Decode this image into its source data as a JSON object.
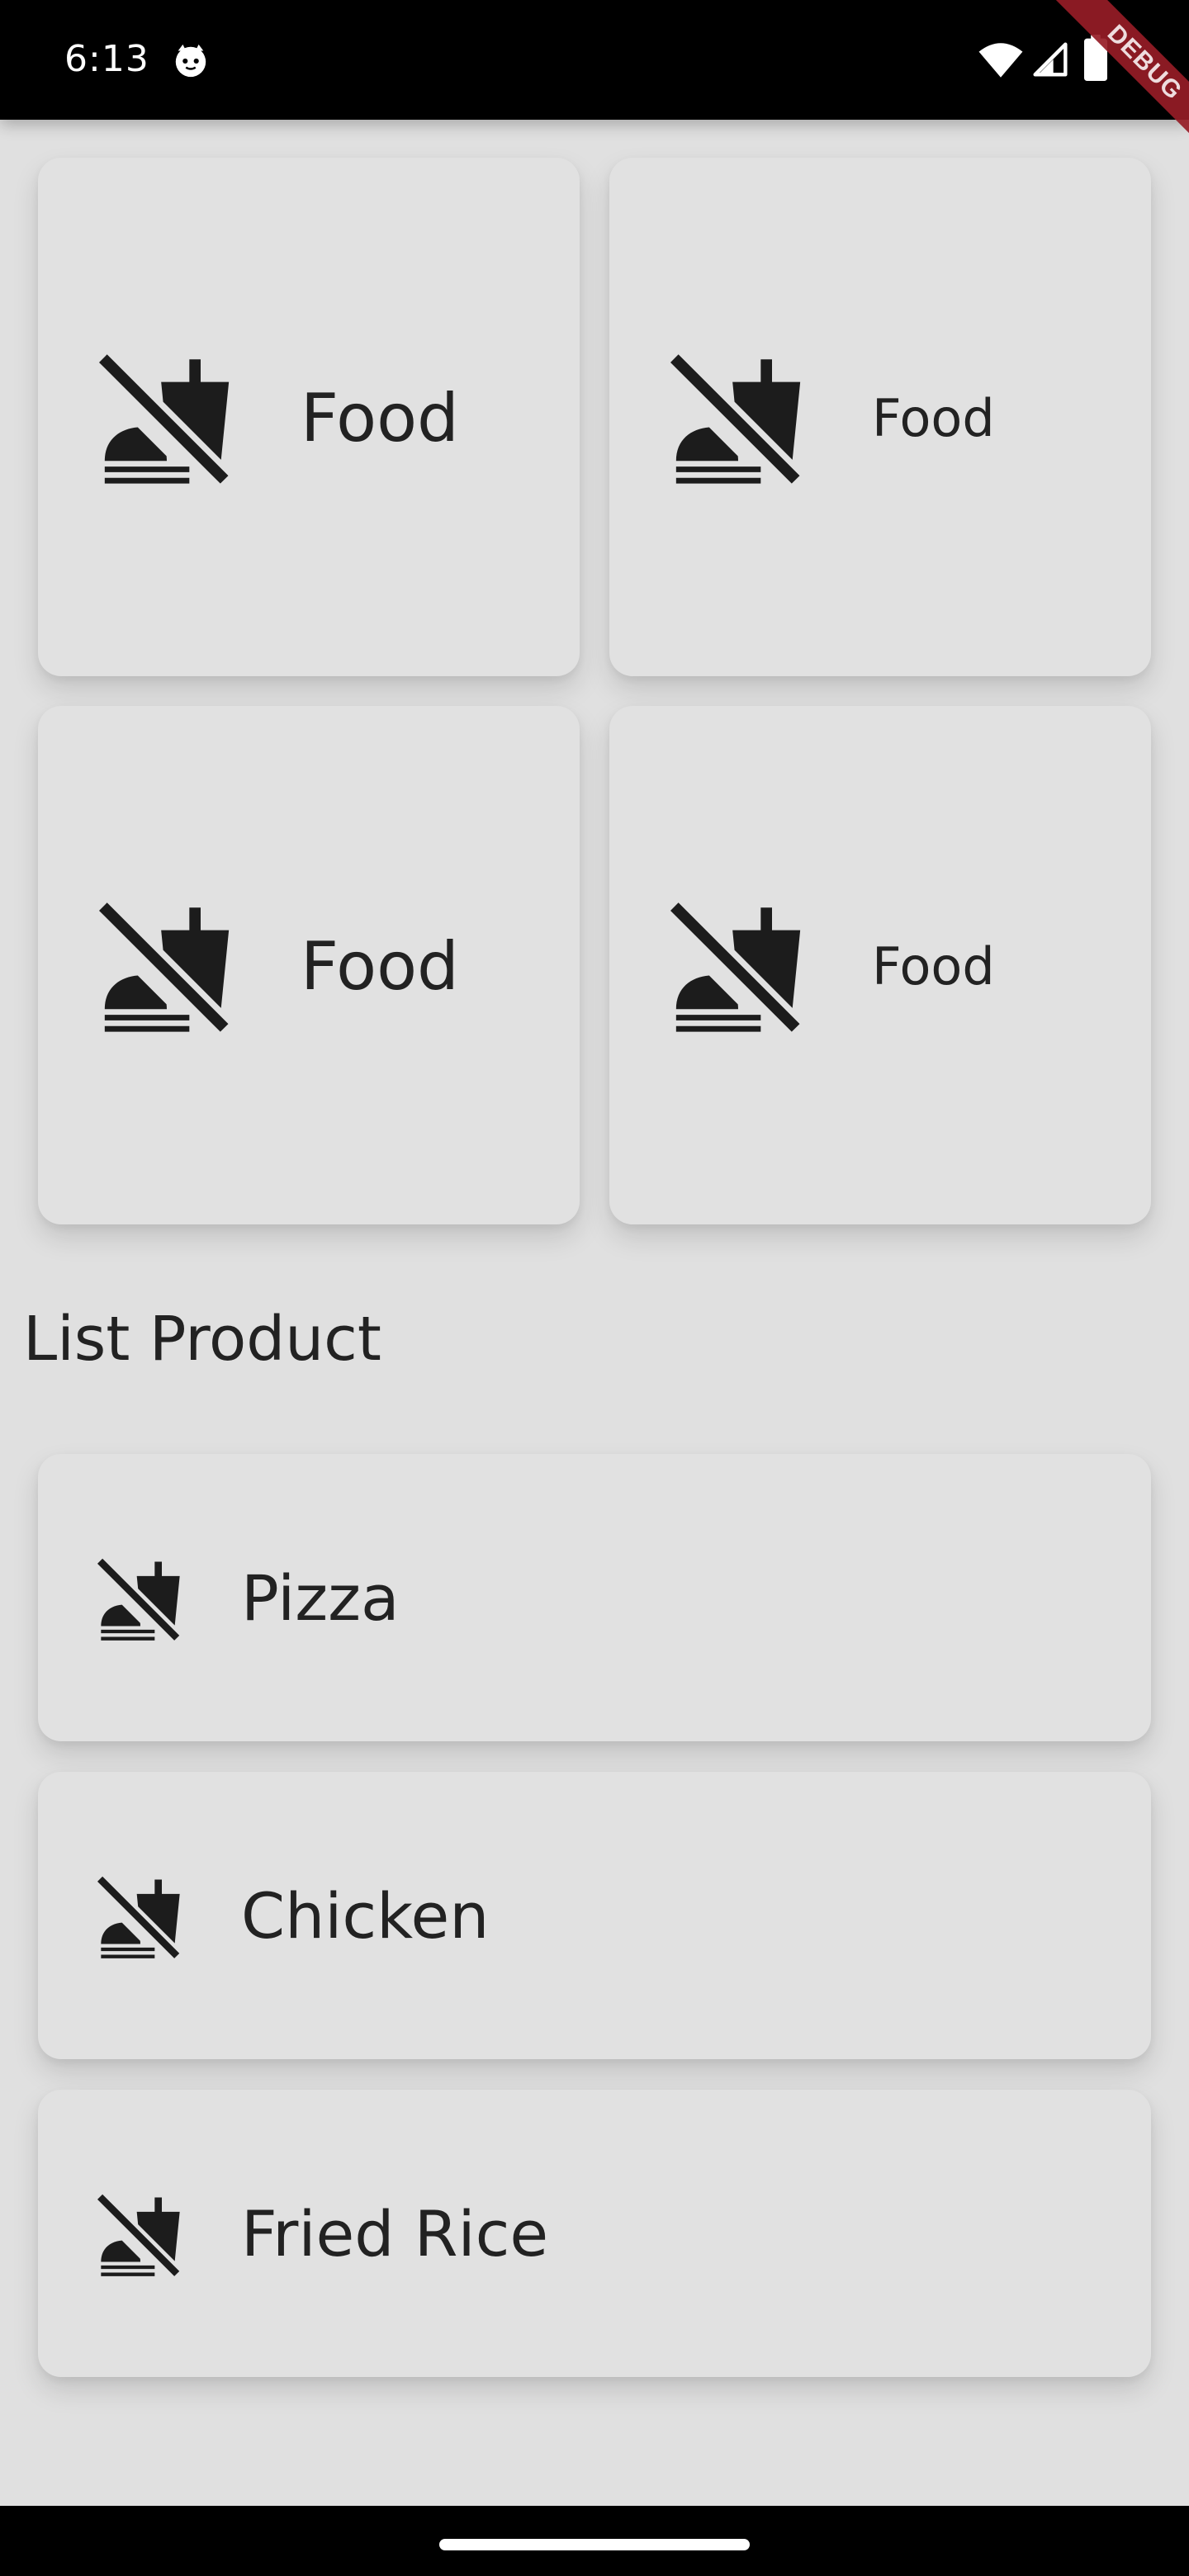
{
  "status_bar": {
    "time": "6:13",
    "app_icon": "cat-face-icon",
    "wifi_icon": "wifi-icon",
    "signal_icon": "cell-signal-icon",
    "battery_icon": "battery-icon"
  },
  "debug_banner": "DEBUG",
  "grid": {
    "icon": "no-food-icon",
    "items": [
      {
        "label": "Food"
      },
      {
        "label": "Food"
      },
      {
        "label": "Food"
      },
      {
        "label": "Food"
      }
    ]
  },
  "section_title": "List Product",
  "products": {
    "icon": "no-food-icon",
    "items": [
      {
        "label": "Pizza"
      },
      {
        "label": "Chicken"
      },
      {
        "label": "Fried Rice"
      }
    ]
  },
  "nav_bar": {
    "handle": "gesture-handle"
  },
  "colors": {
    "background": "#e0e0e0",
    "card": "#e1e1e1",
    "text": "#222222",
    "status_bar": "#000000",
    "debug_ribbon": "#961c26"
  }
}
